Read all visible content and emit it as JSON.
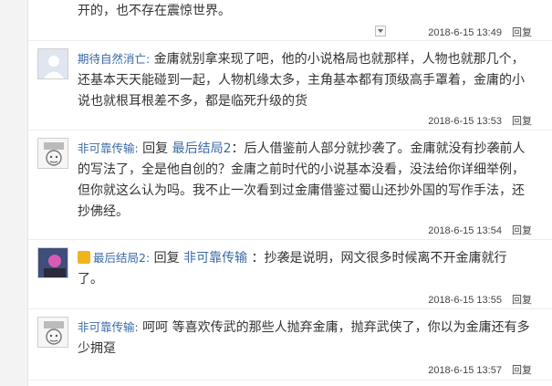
{
  "top_fragment": "开的，也不存在震惊世界。",
  "top_meta": {
    "time": "2018-6-15 13:49",
    "reply": "回复"
  },
  "comments": [
    {
      "user": "期待自然消亡:",
      "text": "金庸就别拿来现了吧，他的小说格局也就那样，人物也就那几个，还基本天天能碰到一起，人物机缘太多，主角基本都有顶级高手罩着，金庸的小说也就根耳根差不多，都是临死升级的货",
      "time": "2018-6-15 13:53",
      "reply": "回复"
    },
    {
      "user": "非可靠传输:",
      "prefix": " 回复 ",
      "mention": "最后结局2",
      "text": "：后人借鉴前人部分就抄袭了。金庸就没有抄袭前人的写法了，全是他自创的？金庸之前时代的小说基本没看，没法给你详细举例，但你就这么认为吗。我不止一次看到过金庸借鉴过蜀山还抄外国的写作手法，还抄佛经。",
      "time": "2018-6-15 13:54",
      "reply": "回复"
    },
    {
      "user": "最后结局2:",
      "prefix": " 回复 ",
      "mention": "非可靠传输",
      "text": " ：抄袭是说明，网文很多时候离不开金庸就行了。",
      "time": "2018-6-15 13:55",
      "reply": "回复"
    },
    {
      "user": "非可靠传输:",
      "text": " 呵呵 等喜欢传武的那些人抛弃金庸，抛弃武侠了，你以为金庸还有多少拥趸",
      "time": "2018-6-15 13:57",
      "reply": "回复"
    }
  ],
  "colors": {
    "username": "#3a6aa5",
    "text": "#333333",
    "badge": "#f2b31c"
  }
}
